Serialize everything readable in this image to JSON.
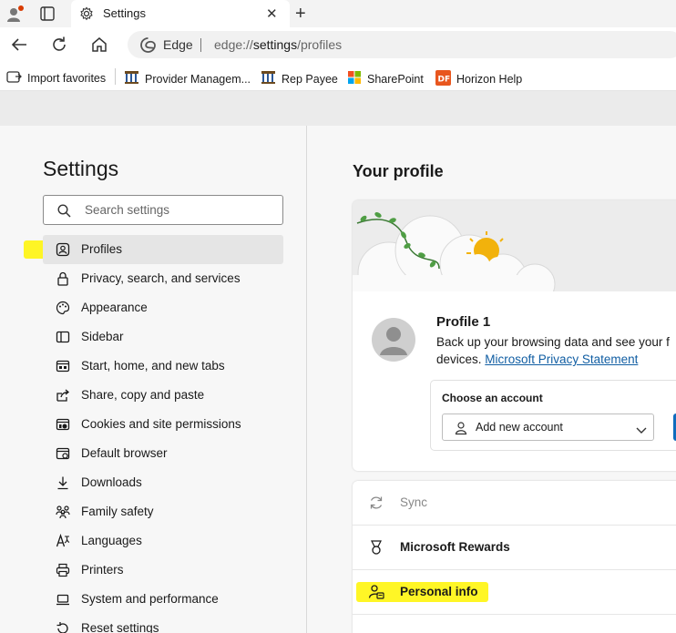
{
  "browser": {
    "tab_title": "Settings",
    "address_prefix": "Edge",
    "url_scheme": "edge://",
    "url_bold": "settings",
    "url_rest": "/profiles"
  },
  "favorites": [
    {
      "label": "Import favorites",
      "icon": "import-icon"
    },
    {
      "label": "Provider Managem...",
      "icon": "building-icon"
    },
    {
      "label": "Rep Payee",
      "icon": "building-icon"
    },
    {
      "label": "SharePoint",
      "icon": "windows-logo-icon"
    },
    {
      "label": "Horizon Help",
      "icon": "df-icon"
    }
  ],
  "sidebar": {
    "title": "Settings",
    "search_placeholder": "Search settings",
    "items": [
      {
        "label": "Profiles",
        "icon": "profile-icon"
      },
      {
        "label": "Privacy, search, and services",
        "icon": "lock-icon"
      },
      {
        "label": "Appearance",
        "icon": "palette-icon"
      },
      {
        "label": "Sidebar",
        "icon": "sidebar-icon"
      },
      {
        "label": "Start, home, and new tabs",
        "icon": "home-tabs-icon"
      },
      {
        "label": "Share, copy and paste",
        "icon": "share-icon"
      },
      {
        "label": "Cookies and site permissions",
        "icon": "cookies-icon"
      },
      {
        "label": "Default browser",
        "icon": "browser-icon"
      },
      {
        "label": "Downloads",
        "icon": "download-icon"
      },
      {
        "label": "Family safety",
        "icon": "family-icon"
      },
      {
        "label": "Languages",
        "icon": "language-icon"
      },
      {
        "label": "Printers",
        "icon": "printer-icon"
      },
      {
        "label": "System and performance",
        "icon": "laptop-icon"
      },
      {
        "label": "Reset settings",
        "icon": "reset-icon"
      }
    ]
  },
  "main": {
    "heading": "Your profile",
    "profile_name": "Profile 1",
    "profile_desc_line1": "Back up your browsing data and see your f",
    "profile_desc_line2_prefix": "devices.",
    "privacy_link": "Microsoft Privacy Statement",
    "choose_account_label": "Choose an account",
    "add_account": "Add new account",
    "rows": [
      {
        "label": "Sync",
        "icon": "sync-icon",
        "disabled": true
      },
      {
        "label": "Microsoft Rewards",
        "icon": "rewards-icon"
      },
      {
        "label": "Personal info",
        "icon": "personal-info-icon"
      }
    ]
  },
  "colors": {
    "highlight": "#fff500",
    "accent": "#0f6cbd",
    "link": "#115ea3"
  }
}
